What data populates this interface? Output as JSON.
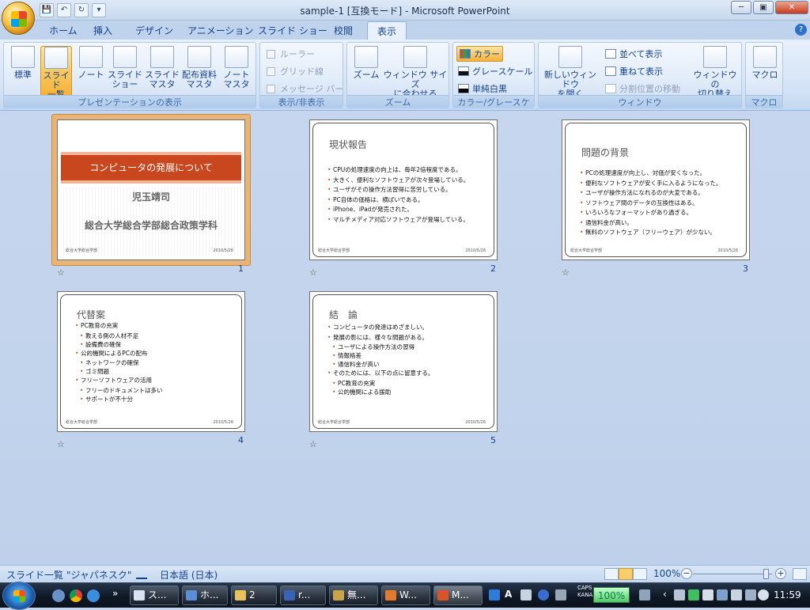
{
  "window": {
    "title": "sample-1 [互換モード] - Microsoft PowerPoint"
  },
  "qat": {
    "save": "💾",
    "undo": "↶",
    "redo": "↻",
    "more": "▾"
  },
  "window_controls": {
    "minimize": "─",
    "maximize": "▣",
    "close": "✕"
  },
  "tabs": [
    "ホーム",
    "挿入",
    "デザイン",
    "アニメーション",
    "スライド ショー",
    "校閲",
    "表示"
  ],
  "active_tab": "表示",
  "help": "?",
  "ribbon": {
    "group_presentation_views": {
      "label": "プレゼンテーションの表示",
      "buttons": {
        "normal": "標準",
        "sorter_1": "スライド",
        "sorter_2": "一覧",
        "notes": "ノート",
        "show_1": "スライド",
        "show_2": "ショー",
        "slide_master_1": "スライド",
        "slide_master_2": "マスタ",
        "handout_master_1": "配布資料",
        "handout_master_2": "マスタ",
        "notes_master_1": "ノート",
        "notes_master_2": "マスタ"
      }
    },
    "group_show_hide": {
      "label": "表示/非表示",
      "ruler": "ルーラー",
      "gridlines": "グリッド線",
      "message_bar": "メッセージ バー"
    },
    "group_zoom": {
      "label": "ズーム",
      "zoom": "ズーム",
      "fit_1": "ウィンドウ サイズ",
      "fit_2": "に合わせる"
    },
    "group_color": {
      "label": "カラー/グレースケール",
      "color": "カラー",
      "grayscale": "グレースケール",
      "bw": "単純白黒"
    },
    "group_window": {
      "label": "ウィンドウ",
      "new_window_1": "新しいウィンドウ",
      "new_window_2": "を開く",
      "arrange_all": "並べて表示",
      "cascade": "重ねて表示",
      "move_split": "分割位置の移動",
      "switch_1": "ウィンドウの",
      "switch_2": "切り替え"
    },
    "group_macro": {
      "label": "マクロ",
      "macros": "マクロ"
    }
  },
  "slides": [
    {
      "number": "1",
      "type": "title",
      "title": "コンピュータの発展について",
      "author": "児玉靖司",
      "org": "総合大学総合学部総合政策学科",
      "footer_left": "総合大学総合学部",
      "footer_right": "2010/5/26"
    },
    {
      "number": "2",
      "title": "現状報告",
      "items": [
        {
          "text": "CPUの処理速度の向上は、毎年2倍程度である。",
          "level": 1
        },
        {
          "text": "大きく、便利なソフトウェアが次々登場している。",
          "level": 1
        },
        {
          "text": "ユーザがその操作方法習得に苦労している。",
          "level": 1
        },
        {
          "text": "PC自体の価格は、横ばいである。",
          "level": 1
        },
        {
          "text": "iPhone、iPadが発売された。",
          "level": 1
        },
        {
          "text": "マルチメディア対応ソフトウェアが登場している。",
          "level": 1
        }
      ],
      "footer_left": "総合大学総合学部",
      "footer_right": "2010/5/26"
    },
    {
      "number": "3",
      "title": "問題の背景",
      "items": [
        {
          "text": "PCの処理速度が向上し、対価が安くなった。",
          "level": 1
        },
        {
          "text": "便利なソフトウェアが安く手に入るようになった。",
          "level": 1
        },
        {
          "text": "ユーザが操作方法になれるのが大変である。",
          "level": 1
        },
        {
          "text": "ソフトウェア間のデータの互換性はある。",
          "level": 1
        },
        {
          "text": "いろいろなフォーマットがあり過ぎる。",
          "level": 1
        },
        {
          "text": "通信料金が高い。",
          "level": 1
        },
        {
          "text": "無料のソフトウェア（フリーウェア）が少ない。",
          "level": 1
        }
      ],
      "footer_left": "総合大学総合学部",
      "footer_right": "2010/5/26"
    },
    {
      "number": "4",
      "title": "代替案",
      "items": [
        {
          "text": "PC教育の充実",
          "level": 1
        },
        {
          "text": "教える側の人材不足",
          "level": 2
        },
        {
          "text": "設備費の確保",
          "level": 2
        },
        {
          "text": "公的機関によるPCの配布",
          "level": 1
        },
        {
          "text": "ネットワークの確保",
          "level": 2
        },
        {
          "text": "ゴミ問題",
          "level": 2
        },
        {
          "text": "フリーソフトウェアの活用",
          "level": 1
        },
        {
          "text": "フリーのドキュメントは多い",
          "level": 2
        },
        {
          "text": "サポートが不十分",
          "level": 2
        }
      ],
      "footer_left": "総合大学総合学部",
      "footer_right": "2010/5/26"
    },
    {
      "number": "5",
      "title": "結　論",
      "items": [
        {
          "text": "コンピュータの発達はめざましい。",
          "level": 1
        },
        {
          "text": "発展の影には、様々な問題がある。",
          "level": 1
        },
        {
          "text": "ユーザによる操作方法の習得",
          "level": 2
        },
        {
          "text": "情報格差",
          "level": 2
        },
        {
          "text": "通信料金が高い",
          "level": 2
        },
        {
          "text": "そのためには、以下の点に留意する。",
          "level": 1
        },
        {
          "text": "PC教育の充実",
          "level": 2
        },
        {
          "text": "公的機関による援助",
          "level": 2
        }
      ],
      "footer_left": "総合大学総合学部",
      "footer_right": "2010/5/26"
    }
  ],
  "slide_star": "☆",
  "statusbar": {
    "view": "スライド一覧",
    "theme": "\"ジャパネスク\"",
    "language": "日本語 (日本)",
    "zoom": "100%",
    "zoom_minus": "−",
    "zoom_plus": "+"
  },
  "taskbar": {
    "items": [
      {
        "label": "ス..."
      },
      {
        "label": "ホ..."
      },
      {
        "label": "2"
      },
      {
        "label": "r..."
      },
      {
        "label": "無..."
      },
      {
        "label": "W..."
      },
      {
        "label": "M..."
      }
    ],
    "chevron": "»",
    "ime_mode": "A",
    "caps": "CAPS",
    "kana": "KANA",
    "percent": "100%",
    "clock": "11:59"
  }
}
